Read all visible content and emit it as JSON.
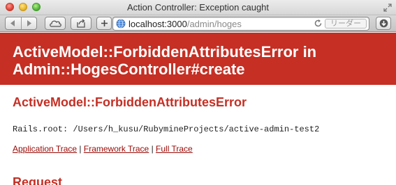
{
  "window": {
    "title": "Action Controller: Exception caught"
  },
  "toolbar": {
    "url_host": "localhost:3000",
    "url_path": "/admin/hoges",
    "reader_label": "リーダー"
  },
  "page": {
    "header_title": "ActiveModel::ForbiddenAttributesError in Admin::HogesController#create",
    "error_name": "ActiveModel::ForbiddenAttributesError",
    "rails_root": "Rails.root: /Users/h_kusu/RubymineProjects/active-admin-test2",
    "trace_links": {
      "application": "Application Trace",
      "framework": "Framework Trace",
      "full": "Full Trace",
      "separator": "|"
    },
    "request_heading": "Request"
  },
  "colors": {
    "header_bg": "#c52f24",
    "link": "#980905"
  },
  "icons": [
    "close-window-icon",
    "minimize-window-icon",
    "zoom-window-icon",
    "fullscreen-icon",
    "back-arrow-icon",
    "forward-arrow-icon",
    "icloud-tabs-icon",
    "share-icon",
    "new-tab-plus-icon",
    "globe-icon",
    "reload-icon",
    "downloads-icon"
  ]
}
